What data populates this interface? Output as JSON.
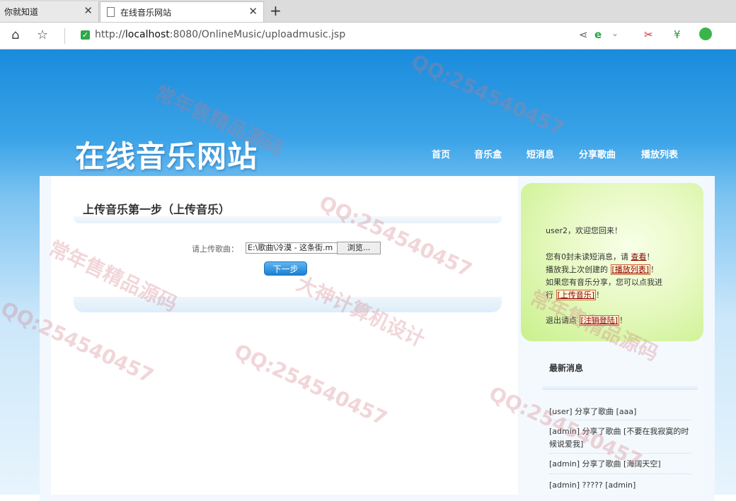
{
  "browser": {
    "tabs": [
      {
        "label": "你就知道"
      },
      {
        "label": "在线音乐网站"
      }
    ],
    "new_tab_symbol": "+",
    "url_prefix": "http://",
    "url_host": "localhost",
    "url_rest": ":8080/OnlineMusic/uploadmusic.jsp"
  },
  "site": {
    "logo": "在线音乐网站",
    "menu": [
      "首页",
      "音乐盒",
      "短消息",
      "分享歌曲",
      "播放列表"
    ]
  },
  "upload": {
    "heading": "上传音乐第一步（上传音乐）",
    "label": "请上传歌曲：",
    "file_value": "E:\\歌曲\\冷漠 - 这条街.m",
    "browse_label": "浏览...",
    "next_label": "下一步"
  },
  "sidebar": {
    "welcome": "user2，欢迎您回来！",
    "line1_pre": "您有0封未读短消息，请 ",
    "line1_link": "查看",
    "line1_post": "！",
    "line2_pre": "播放我上次创建的 ",
    "line2_link": "[播放列表]",
    "line2_post": "！",
    "line3": "如果您有音乐分享，您可以点我进",
    "line4_pre": "行 ",
    "line4_link": "[上传音乐]",
    "line4_post": "！",
    "logout_pre": "退出请点 ",
    "logout_link": "[注销登陆]",
    "logout_post": "！",
    "news_title": "最新消息",
    "news": [
      "[user] 分享了歌曲 [aaa]",
      "[admin]  分享了歌曲   [不要在我寂寞的时候说爱我]",
      "[admin] 分享了歌曲 [海阔天空]",
      "[admin] ????? [admin]"
    ]
  },
  "watermarks": [
    "常年售精品源码",
    "QQ:254540457",
    "大神计算机设计"
  ]
}
